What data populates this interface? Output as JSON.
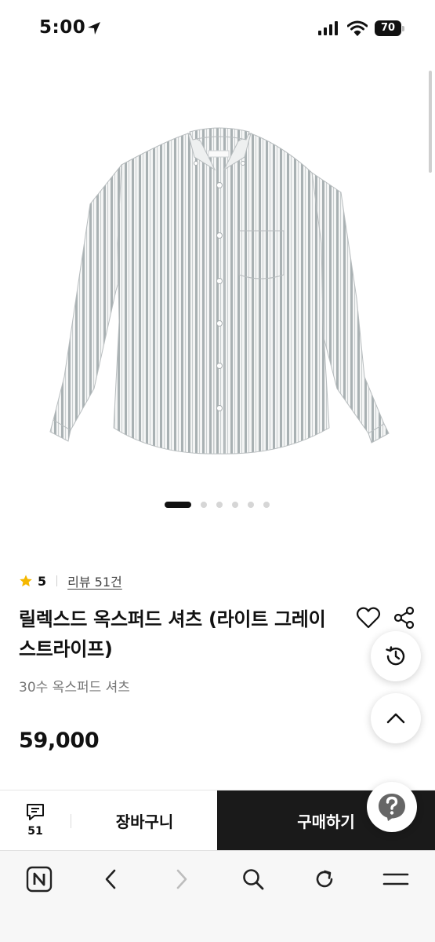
{
  "status_bar": {
    "time": "5:00",
    "battery": "70"
  },
  "carousel": {
    "total": 6,
    "active": 1
  },
  "product": {
    "rating": "5",
    "review_link": "리뷰 51건",
    "title": "릴렉스드 옥스퍼드 셔츠 (라이트 그레이 스트라이프)",
    "subtitle": "30수 옥스퍼드 셔츠",
    "price": "59,000",
    "image_alt": "light grey stripe oxford shirt",
    "star_color": "#F5B800"
  },
  "purchase_bar": {
    "review_count": "51",
    "cart_label": "장바구니",
    "buy_label": "구매하기",
    "buy_bg": "#1A1A1A"
  },
  "icons": {
    "like": "heart-icon",
    "share": "share-icon",
    "history": "history-icon",
    "scroll_top": "chevron-up-icon",
    "help": "question-icon",
    "reviews": "chat-icon",
    "browser": [
      "naver-home-icon",
      "back-icon",
      "forward-icon",
      "search-icon",
      "reload-icon",
      "menu-icon"
    ]
  }
}
